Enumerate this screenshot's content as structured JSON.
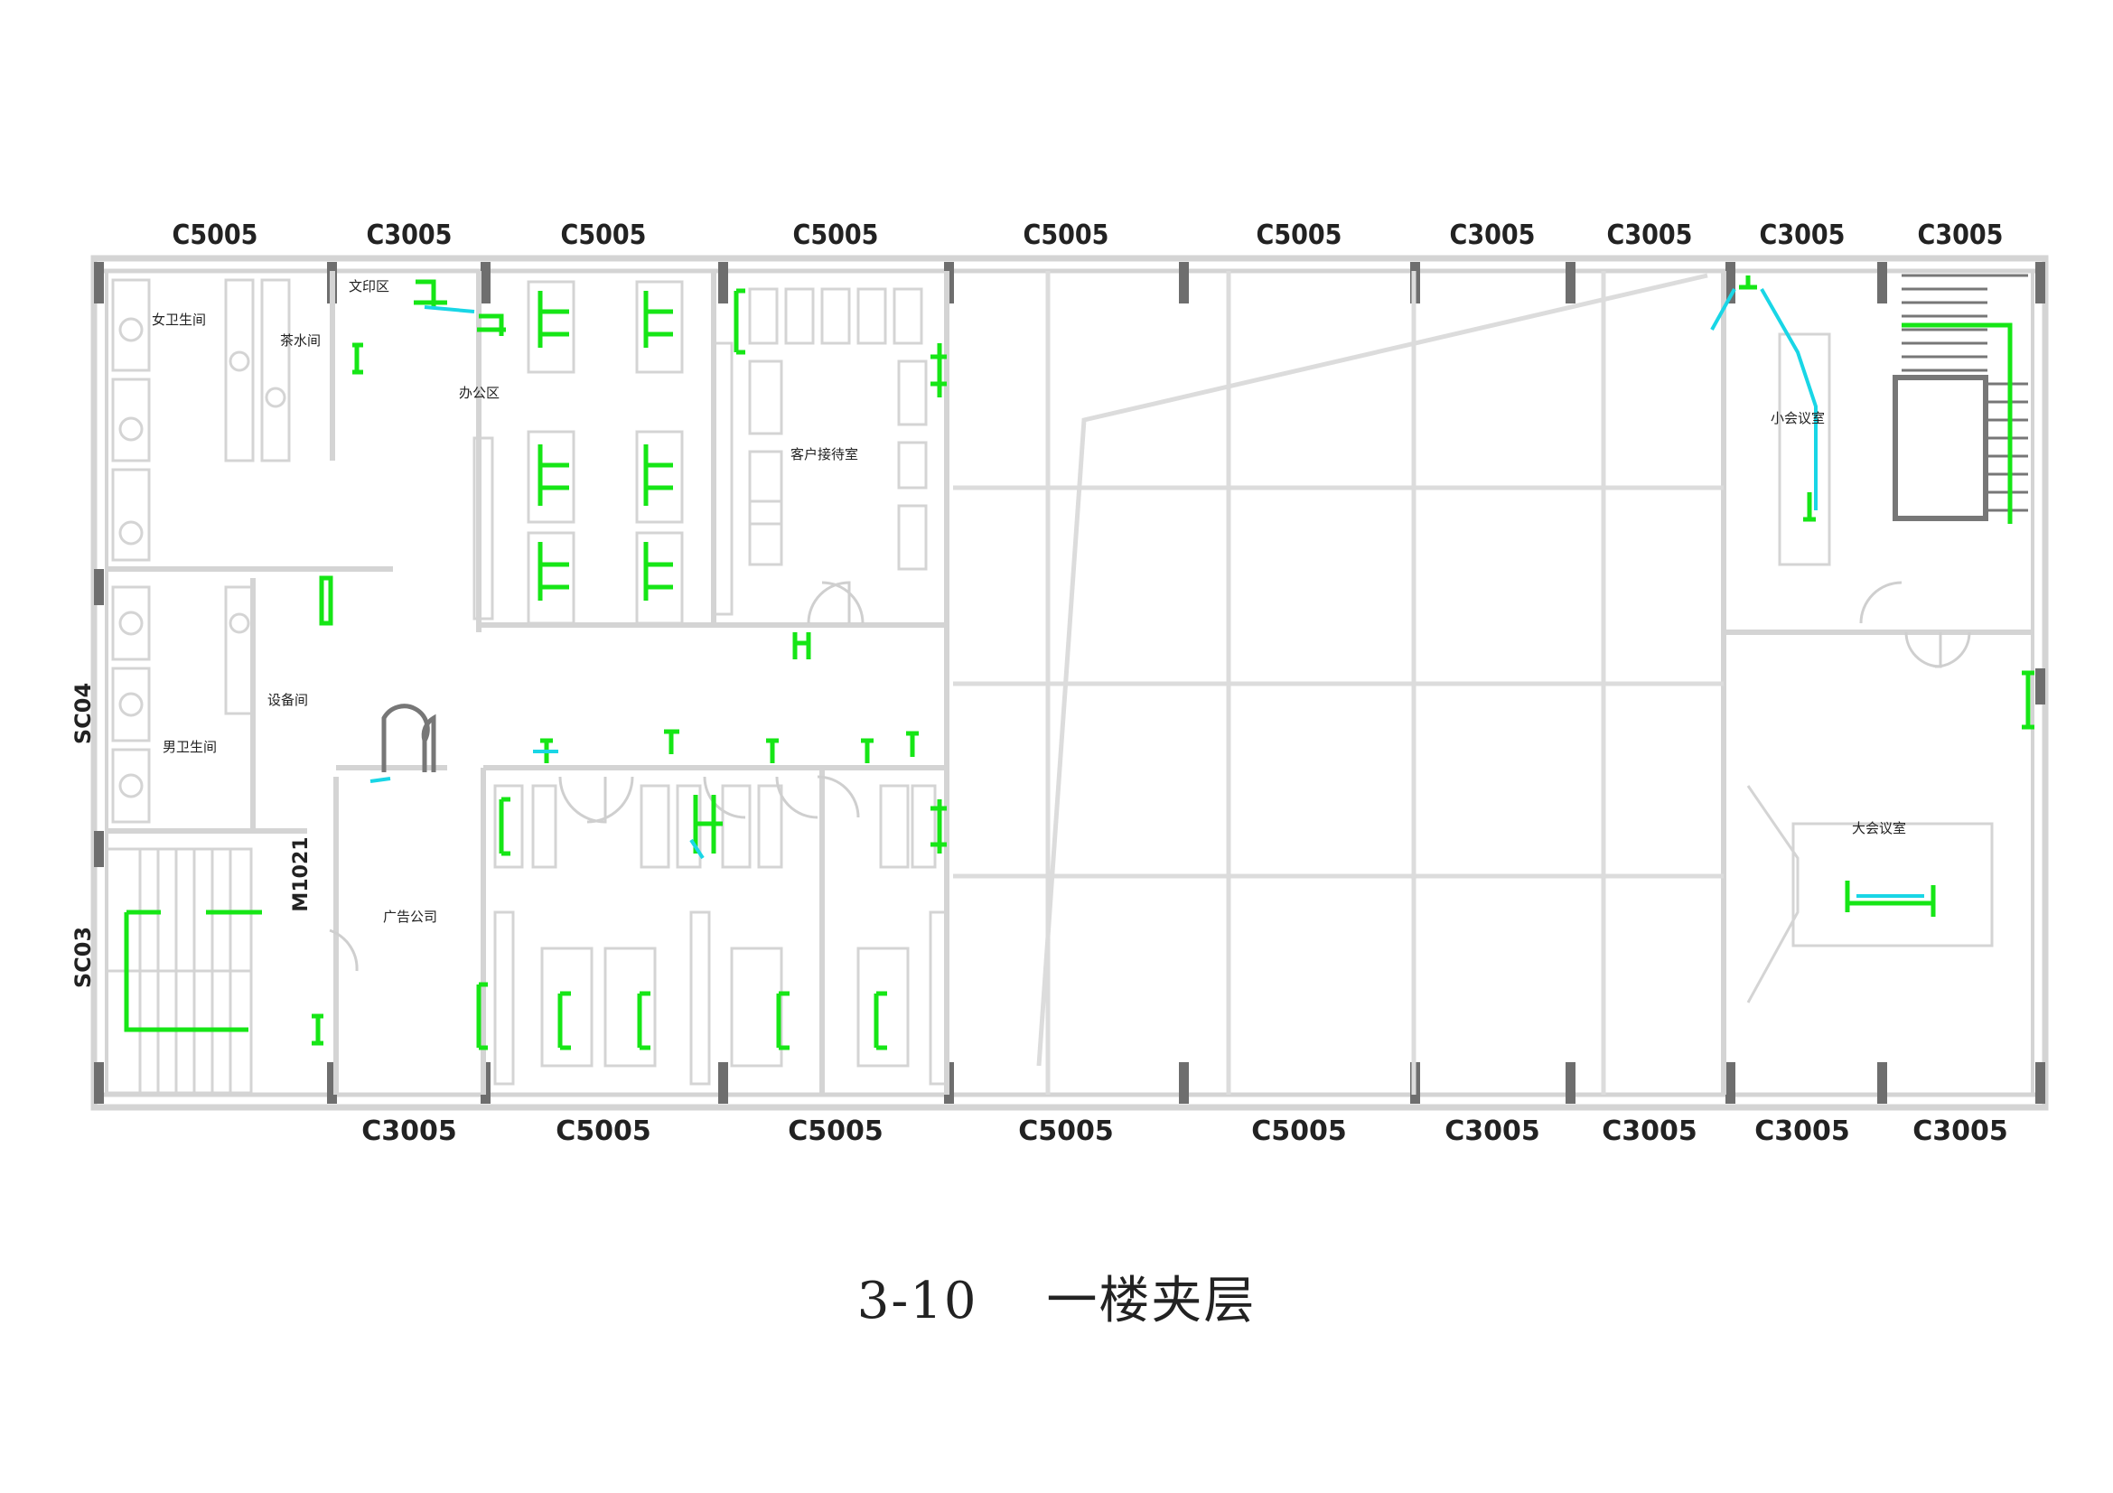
{
  "window_labels_top": [
    "C5005",
    "C3005",
    "C5005",
    "C5005",
    "C5005",
    "C5005",
    "C3005",
    "C3005",
    "C3005",
    "C3005"
  ],
  "window_labels_bottom": [
    "C3005",
    "C5005",
    "C5005",
    "C5005",
    "C5005",
    "C3005",
    "C3005",
    "C3005",
    "C3005"
  ],
  "side_labels": {
    "upper": "SC04",
    "lower": "SC03"
  },
  "door_label": "M1021",
  "rooms": {
    "womens_restroom": "女卫生间",
    "tea_room": "茶水间",
    "print_area": "文印区",
    "office_area": "办公区",
    "reception": "客户接待室",
    "equipment_room": "设备间",
    "mens_restroom": "男卫生间",
    "ad_company": "广告公司",
    "small_meeting_room": "小会议室",
    "large_meeting_room": "大会议室"
  },
  "caption": {
    "number": "3-10",
    "title": "一楼夹层"
  },
  "colors": {
    "wall": "#d4d4d4",
    "column": "#6e6e6e",
    "text": "#222222",
    "equipment_green": "#16e616",
    "duct_cyan": "#19d6e6"
  }
}
